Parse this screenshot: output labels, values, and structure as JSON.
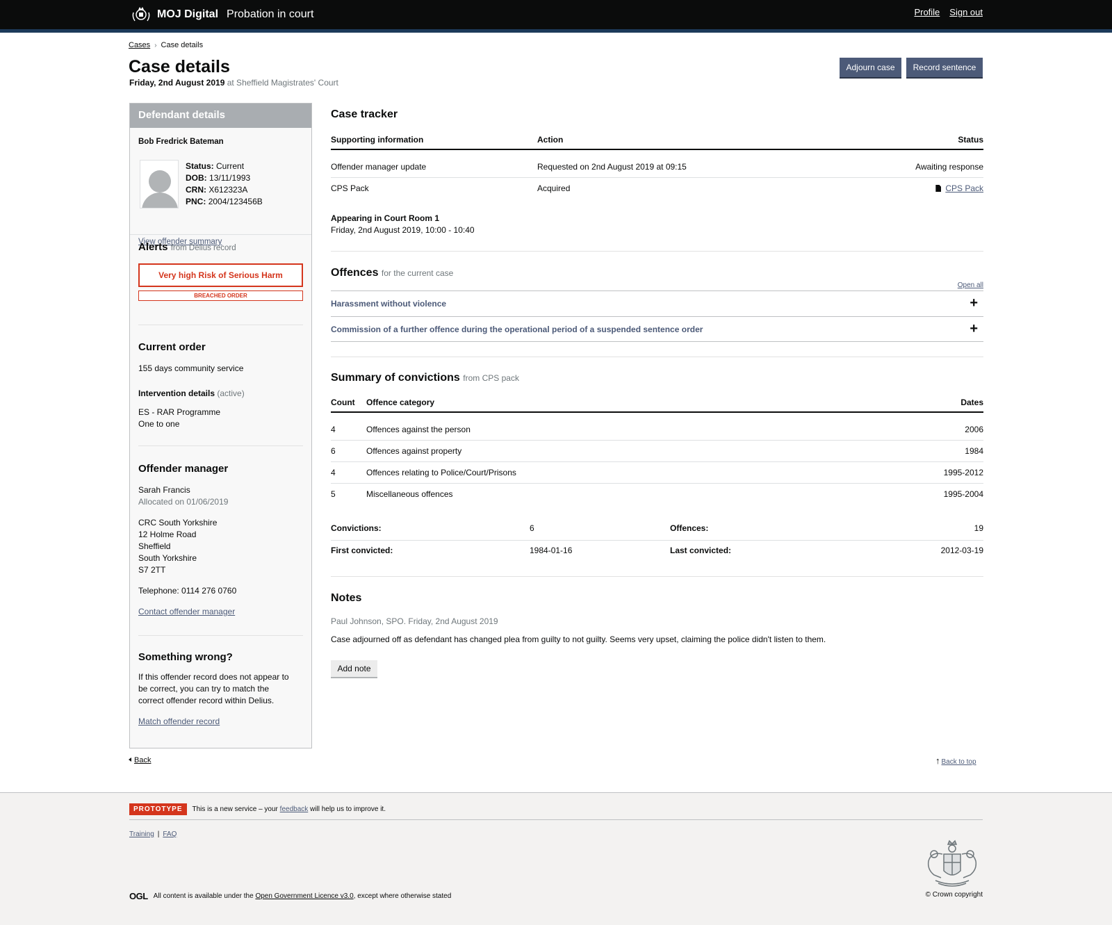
{
  "header": {
    "brand": "MOJ Digital",
    "service": "Probation in court",
    "links": [
      "Profile",
      "Sign out"
    ]
  },
  "breadcrumb": {
    "parent": "Cases",
    "current": "Case details"
  },
  "page": {
    "title": "Case details",
    "date": "Friday, 2nd August 2019",
    "court": "at Sheffield Magistrates' Court",
    "actions": [
      "Adjourn case",
      "Record sentence"
    ]
  },
  "sidebar": {
    "heading": "Defendant details",
    "name": "Bob Fredrick Bateman",
    "details": [
      {
        "label": "Status:",
        "value": "Current"
      },
      {
        "label": "DOB:",
        "value": "13/11/1993"
      },
      {
        "label": "CRN:",
        "value": "X612323A"
      },
      {
        "label": "PNC:",
        "value": "2004/123456B"
      }
    ],
    "summary_link": "View offender summary",
    "alerts": {
      "title": "Alerts",
      "source": "from Delius record",
      "primary": "Very high Risk of Serious Harm",
      "secondary": "BREACHED ORDER"
    },
    "current_order": {
      "title": "Current order",
      "text": "155 days community service",
      "intervention_title": "Intervention details",
      "intervention_state": "(active)",
      "line1": "ES - RAR Programme",
      "line2": "One to one"
    },
    "offender_manager": {
      "title": "Offender manager",
      "name": "Sarah Francis",
      "allocated": "Allocated on 01/06/2019",
      "address": [
        "CRC South Yorkshire",
        "12 Holme Road",
        "Sheffield",
        "South Yorkshire",
        "S7 2TT"
      ],
      "telephone": "Telephone: 0114 276 0760",
      "contact_link": "Contact offender manager"
    },
    "wrong": {
      "title": "Something wrong?",
      "lines": [
        "If this offender record does not appear to",
        "be correct, you can try to match the",
        "correct offender record within Delius."
      ],
      "link": "Match offender record"
    }
  },
  "tracker": {
    "title": "Case tracker",
    "headers": [
      "Supporting information",
      "Action",
      "Status"
    ],
    "rows": [
      {
        "info": "Offender manager update",
        "action": "Requested on 2nd August 2019 at 09:15",
        "status": "Awaiting response"
      },
      {
        "info": "CPS Pack",
        "action": "Acquired",
        "status": "CPS Pack"
      }
    ],
    "appearing_title": "Appearing in Court Room 1",
    "appearing_time": "Friday, 2nd August 2019, 10:00 - 10:40"
  },
  "offences": {
    "title": "Offences",
    "qualifier": "for the current case",
    "open_all": "Open all",
    "items": [
      "Harassment without violence",
      "Commission of a further offence during the operational period of a suspended sentence order"
    ],
    "expand_symbol": "+"
  },
  "convictions": {
    "title": "Summary of convictions",
    "qualifier": "from CPS pack",
    "headers": [
      "Count",
      "Offence category",
      "Dates"
    ],
    "rows": [
      {
        "count": "4",
        "category": "Offences against the person",
        "dates": "2006"
      },
      {
        "count": "6",
        "category": "Offences against property",
        "dates": "1984"
      },
      {
        "count": "4",
        "category": "Offences relating to Police/Court/Prisons",
        "dates": "1995-2012"
      },
      {
        "count": "5",
        "category": "Miscellaneous offences",
        "dates": "1995-2004"
      }
    ],
    "stats": [
      {
        "label1": "Convictions:",
        "value1": "6",
        "label2": "Offences:",
        "value2": "19"
      },
      {
        "label1": "First convicted:",
        "value1": "1984-01-16",
        "label2": "Last convicted:",
        "value2": "2012-03-19"
      }
    ]
  },
  "notes": {
    "title": "Notes",
    "meta": "Paul Johnson, SPO. Friday, 2nd August 2019",
    "body": "Case adjourned off as defendant has changed plea from guilty to not guilty. Seems very upset, claiming the police didn't listen to them.",
    "add_label": "Add note"
  },
  "nav": {
    "back": "Back",
    "top": "Back to top"
  },
  "footer": {
    "phase": "PROTOTYPE",
    "phase_text_pre": "This is a new service – your",
    "phase_link": "feedback",
    "phase_text_post": "will help us to improve it.",
    "links": [
      "Training",
      "FAQ"
    ],
    "ogl_logo": "OGL",
    "licence_pre": "All content is available under the",
    "licence_link": "Open Government Licence v3.0",
    "licence_post": ", except where otherwise stated",
    "copyright": "© Crown copyright"
  },
  "colors": {
    "header": "#0b0c0c",
    "accent": "#4c5a78",
    "alert": "#d4351c"
  }
}
